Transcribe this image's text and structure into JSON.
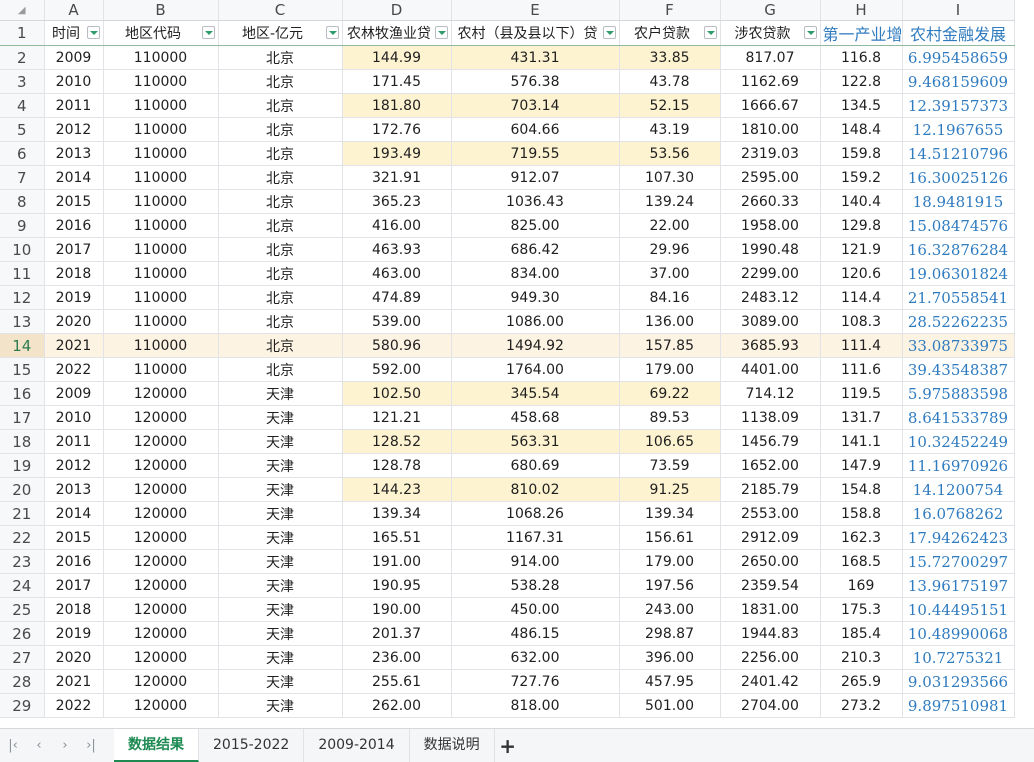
{
  "columns": [
    "A",
    "B",
    "C",
    "D",
    "E",
    "F",
    "G",
    "H",
    "I"
  ],
  "header_row_number": "1",
  "header": [
    "时间",
    "地区代码",
    "地区-亿元",
    "农林牧渔业贷",
    "农村（县及县以下）贷",
    "农户贷款",
    "涉农贷款",
    "第一产业增",
    "农村金融发展"
  ],
  "selected_row": 14,
  "rows": [
    {
      "n": "2",
      "cells": [
        "2009",
        "110000",
        "北京",
        "144.99",
        "431.31",
        "33.85",
        "817.07",
        "116.8",
        "6.995458659"
      ]
    },
    {
      "n": "3",
      "cells": [
        "2010",
        "110000",
        "北京",
        "171.45",
        "576.38",
        "43.78",
        "1162.69",
        "122.8",
        "9.468159609"
      ]
    },
    {
      "n": "4",
      "cells": [
        "2011",
        "110000",
        "北京",
        "181.80",
        "703.14",
        "52.15",
        "1666.67",
        "134.5",
        "12.39157373"
      ]
    },
    {
      "n": "5",
      "cells": [
        "2012",
        "110000",
        "北京",
        "172.76",
        "604.66",
        "43.19",
        "1810.00",
        "148.4",
        "12.1967655"
      ]
    },
    {
      "n": "6",
      "cells": [
        "2013",
        "110000",
        "北京",
        "193.49",
        "719.55",
        "53.56",
        "2319.03",
        "159.8",
        "14.51210796"
      ]
    },
    {
      "n": "7",
      "cells": [
        "2014",
        "110000",
        "北京",
        "321.91",
        "912.07",
        "107.30",
        "2595.00",
        "159.2",
        "16.30025126"
      ]
    },
    {
      "n": "8",
      "cells": [
        "2015",
        "110000",
        "北京",
        "365.23",
        "1036.43",
        "139.24",
        "2660.33",
        "140.4",
        "18.9481915"
      ]
    },
    {
      "n": "9",
      "cells": [
        "2016",
        "110000",
        "北京",
        "416.00",
        "825.00",
        "22.00",
        "1958.00",
        "129.8",
        "15.08474576"
      ]
    },
    {
      "n": "10",
      "cells": [
        "2017",
        "110000",
        "北京",
        "463.93",
        "686.42",
        "29.96",
        "1990.48",
        "121.9",
        "16.32876284"
      ]
    },
    {
      "n": "11",
      "cells": [
        "2018",
        "110000",
        "北京",
        "463.00",
        "834.00",
        "37.00",
        "2299.00",
        "120.6",
        "19.06301824"
      ]
    },
    {
      "n": "12",
      "cells": [
        "2019",
        "110000",
        "北京",
        "474.89",
        "949.30",
        "84.16",
        "2483.12",
        "114.4",
        "21.70558541"
      ]
    },
    {
      "n": "13",
      "cells": [
        "2020",
        "110000",
        "北京",
        "539.00",
        "1086.00",
        "136.00",
        "3089.00",
        "108.3",
        "28.52262235"
      ]
    },
    {
      "n": "14",
      "cells": [
        "2021",
        "110000",
        "北京",
        "580.96",
        "1494.92",
        "157.85",
        "3685.93",
        "111.4",
        "33.08733975"
      ]
    },
    {
      "n": "15",
      "cells": [
        "2022",
        "110000",
        "北京",
        "592.00",
        "1764.00",
        "179.00",
        "4401.00",
        "111.6",
        "39.43548387"
      ]
    },
    {
      "n": "16",
      "cells": [
        "2009",
        "120000",
        "天津",
        "102.50",
        "345.54",
        "69.22",
        "714.12",
        "119.5",
        "5.975883598"
      ]
    },
    {
      "n": "17",
      "cells": [
        "2010",
        "120000",
        "天津",
        "121.21",
        "458.68",
        "89.53",
        "1138.09",
        "131.7",
        "8.641533789"
      ]
    },
    {
      "n": "18",
      "cells": [
        "2011",
        "120000",
        "天津",
        "128.52",
        "563.31",
        "106.65",
        "1456.79",
        "141.1",
        "10.32452249"
      ]
    },
    {
      "n": "19",
      "cells": [
        "2012",
        "120000",
        "天津",
        "128.78",
        "680.69",
        "73.59",
        "1652.00",
        "147.9",
        "11.16970926"
      ]
    },
    {
      "n": "20",
      "cells": [
        "2013",
        "120000",
        "天津",
        "144.23",
        "810.02",
        "91.25",
        "2185.79",
        "154.8",
        "14.1200754"
      ]
    },
    {
      "n": "21",
      "cells": [
        "2014",
        "120000",
        "天津",
        "139.34",
        "1068.26",
        "139.34",
        "2553.00",
        "158.8",
        "16.0768262"
      ]
    },
    {
      "n": "22",
      "cells": [
        "2015",
        "120000",
        "天津",
        "165.51",
        "1167.31",
        "156.61",
        "2912.09",
        "162.3",
        "17.94262423"
      ]
    },
    {
      "n": "23",
      "cells": [
        "2016",
        "120000",
        "天津",
        "191.00",
        "914.00",
        "179.00",
        "2650.00",
        "168.5",
        "15.72700297"
      ]
    },
    {
      "n": "24",
      "cells": [
        "2017",
        "120000",
        "天津",
        "190.95",
        "538.28",
        "197.56",
        "2359.54",
        "169",
        "13.96175197"
      ]
    },
    {
      "n": "25",
      "cells": [
        "2018",
        "120000",
        "天津",
        "190.00",
        "450.00",
        "243.00",
        "1831.00",
        "175.3",
        "10.44495151"
      ]
    },
    {
      "n": "26",
      "cells": [
        "2019",
        "120000",
        "天津",
        "201.37",
        "486.15",
        "298.87",
        "1944.83",
        "185.4",
        "10.48990068"
      ]
    },
    {
      "n": "27",
      "cells": [
        "2020",
        "120000",
        "天津",
        "236.00",
        "632.00",
        "396.00",
        "2256.00",
        "210.3",
        "10.7275321"
      ]
    },
    {
      "n": "28",
      "cells": [
        "2021",
        "120000",
        "天津",
        "255.61",
        "727.76",
        "457.95",
        "2401.42",
        "265.9",
        "9.031293566"
      ]
    },
    {
      "n": "29",
      "cells": [
        "2022",
        "120000",
        "天津",
        "262.00",
        "818.00",
        "501.00",
        "2704.00",
        "273.2",
        "9.897510981"
      ]
    }
  ],
  "highlighted_rows": [
    2,
    4,
    6,
    16,
    18,
    20
  ],
  "tabs": [
    "数据结果",
    "2015-2022",
    "2009-2014",
    "数据说明"
  ],
  "active_tab": 0,
  "nav": [
    "|‹",
    "‹",
    "›",
    "›|"
  ],
  "add_tab_label": "+",
  "colors": {
    "accent": "#1e8a52",
    "highlight": "#fdf3d1",
    "selected_row": "#fcf3e2",
    "serif_text": "#2f7bbf"
  }
}
